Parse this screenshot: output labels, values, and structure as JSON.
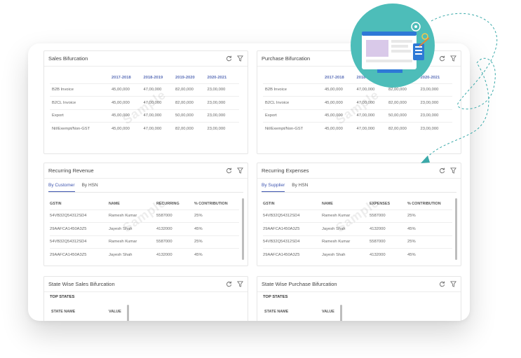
{
  "sales_bifurcation": {
    "title": "Sales Bifurcation",
    "columns": [
      "",
      "2017-2018",
      "2018-2019",
      "2019-2020",
      "2020-2021"
    ],
    "rows": [
      [
        "B2B Invoice",
        "45,00,000",
        "47,00,000",
        "82,00,000",
        "23,00,000"
      ],
      [
        "B2CL Invoice",
        "45,00,000",
        "47,00,000",
        "82,00,000",
        "23,00,000"
      ],
      [
        "Export",
        "45,00,000",
        "47,00,000",
        "50,00,000",
        "23,00,000"
      ],
      [
        "Nil/Exempt/Non-GST",
        "45,00,000",
        "47,00,000",
        "82,00,000",
        "23,00,000"
      ]
    ]
  },
  "purchase_bifurcation": {
    "title": "Purchase Bifurcation",
    "columns": [
      "",
      "2017-2018",
      "2018-2019",
      "2019-2020",
      "2020-2021"
    ],
    "rows": [
      [
        "B2B Invoice",
        "45,00,000",
        "47,00,000",
        "82,00,000",
        "23,00,000"
      ],
      [
        "B2CL Invoice",
        "45,00,000",
        "47,00,000",
        "82,00,000",
        "23,00,000"
      ],
      [
        "Export",
        "45,00,000",
        "47,00,000",
        "50,00,000",
        "23,00,000"
      ],
      [
        "Nil/Exempt/Non-GST",
        "45,00,000",
        "47,00,000",
        "82,00,000",
        "23,00,000"
      ]
    ]
  },
  "recurring_revenue": {
    "title": "Recurring Revenue",
    "tabs": [
      "By Customer",
      "By HSN"
    ],
    "columns": [
      "GSTIN",
      "NAME",
      "RECURRING",
      "% CONTRIBUTION"
    ],
    "rows": [
      [
        "54VB32Q54312SD4",
        "Ramesh Kumar",
        "5587000",
        "25%"
      ],
      [
        "29AAFCA1450A3Z5",
        "Jayesh Shah",
        "4132000",
        "45%"
      ],
      [
        "54VB32Q54312SD4",
        "Ramesh Kumar",
        "5587000",
        "25%"
      ],
      [
        "29AAFCA1450A3Z5",
        "Jayesh Shah",
        "4132000",
        "45%"
      ]
    ]
  },
  "recurring_expenses": {
    "title": "Recurring Expenses",
    "tabs": [
      "By Supplier",
      "By HSN"
    ],
    "columns": [
      "GSTIN",
      "NAME",
      "EXPENSES",
      "% CONTRIBUTION"
    ],
    "rows": [
      [
        "54VB32Q54312SD4",
        "Ramesh Kumar",
        "5587000",
        "25%"
      ],
      [
        "29AAFCA1450A3Z5",
        "Jayesh Shah",
        "4132000",
        "45%"
      ],
      [
        "54VB32Q54312SD4",
        "Ramesh Kumar",
        "5587000",
        "25%"
      ],
      [
        "29AAFCA1450A3Z5",
        "Jayesh Shah",
        "4132000",
        "45%"
      ]
    ]
  },
  "state_sales": {
    "title": "State Wise Sales Bifurcation",
    "subtitle": "TOP STATES",
    "columns": [
      "STATE NAME",
      "VALUE"
    ]
  },
  "state_purchase": {
    "title": "State Wise Purchase Bifurcation",
    "subtitle": "TOP STATES",
    "columns": [
      "STATE NAME",
      "VALUE"
    ]
  },
  "watermark_text": "Sample",
  "icons": {
    "refresh": "refresh-icon",
    "filter": "filter-icon"
  },
  "colors": {
    "accent": "#3f56b0",
    "teal_badge": "#4dbdb9",
    "dashed_line": "#3aa9a9"
  }
}
